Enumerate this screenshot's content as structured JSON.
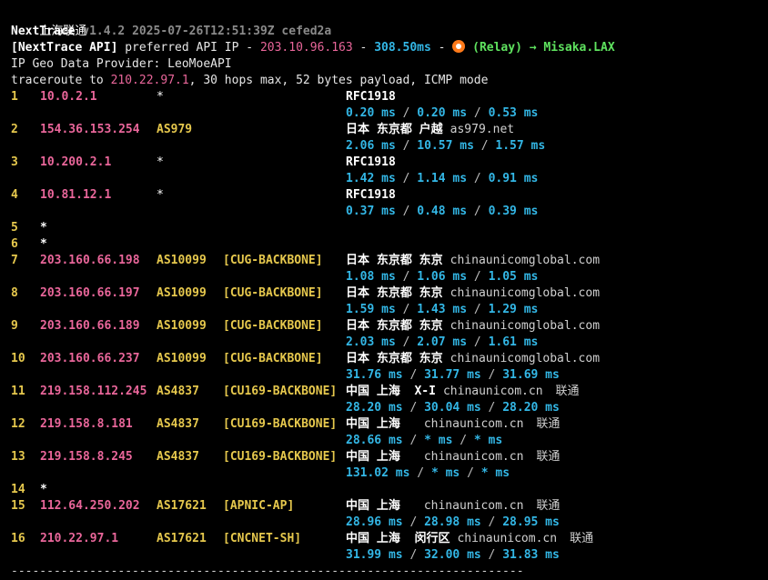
{
  "header": {
    "title": "上海联通",
    "app_name": "NextTrace",
    "version_info": "v1.4.2 2025-07-26T12:51:39Z cefed2a",
    "api_label": "[NextTrace API]",
    "api_text": "preferred API IP -",
    "api_ip": "203.10.96.163",
    "api_dash": "-",
    "api_latency": "308.50ms",
    "api_dash2": "-",
    "relay_text": "(Relay) → Misaka.LAX",
    "geo_provider": "IP Geo Data Provider: LeoMoeAPI",
    "traceroute_prefix": "traceroute to",
    "traceroute_target": "210.22.97.1",
    "traceroute_suffix": ", 30 hops max, 52 bytes payload, ICMP mode"
  },
  "hops": [
    {
      "num": "1",
      "ip": "10.0.2.1",
      "asn": "*",
      "tag": "",
      "geo": "RFC1918",
      "host": "",
      "isp": "",
      "rtt": [
        "0.20 ms",
        "0.20 ms",
        "0.53 ms"
      ]
    },
    {
      "num": "2",
      "ip": "154.36.153.254",
      "asn": "AS979",
      "tag": "",
      "geo": "日本 东京都 户越",
      "host": "as979.net",
      "isp": "",
      "rtt": [
        "2.06 ms",
        "10.57 ms",
        "1.57 ms"
      ]
    },
    {
      "num": "3",
      "ip": "10.200.2.1",
      "asn": "*",
      "tag": "",
      "geo": "RFC1918",
      "host": "",
      "isp": "",
      "rtt": [
        "1.42 ms",
        "1.14 ms",
        "0.91 ms"
      ]
    },
    {
      "num": "4",
      "ip": "10.81.12.1",
      "asn": "*",
      "tag": "",
      "geo": "RFC1918",
      "host": "",
      "isp": "",
      "rtt": [
        "0.37 ms",
        "0.48 ms",
        "0.39 ms"
      ]
    },
    {
      "num": "5",
      "star": "*"
    },
    {
      "num": "6",
      "star": "*"
    },
    {
      "num": "7",
      "ip": "203.160.66.198",
      "asn": "AS10099",
      "tag": "[CUG-BACKBONE]",
      "geo": "日本 东京都 东京",
      "host": "chinaunicomglobal.com",
      "isp": "",
      "rtt": [
        "1.08 ms",
        "1.06 ms",
        "1.05 ms"
      ]
    },
    {
      "num": "8",
      "ip": "203.160.66.197",
      "asn": "AS10099",
      "tag": "[CUG-BACKBONE]",
      "geo": "日本 东京都 东京",
      "host": "chinaunicomglobal.com",
      "isp": "",
      "rtt": [
        "1.59 ms",
        "1.43 ms",
        "1.29 ms"
      ]
    },
    {
      "num": "9",
      "ip": "203.160.66.189",
      "asn": "AS10099",
      "tag": "[CUG-BACKBONE]",
      "geo": "日本 东京都 东京",
      "host": "chinaunicomglobal.com",
      "isp": "",
      "rtt": [
        "2.03 ms",
        "2.07 ms",
        "1.61 ms"
      ]
    },
    {
      "num": "10",
      "ip": "203.160.66.237",
      "asn": "AS10099",
      "tag": "[CUG-BACKBONE]",
      "geo": "日本 东京都 东京",
      "host": "chinaunicomglobal.com",
      "isp": "",
      "rtt": [
        "31.76 ms",
        "31.77 ms",
        "31.69 ms"
      ]
    },
    {
      "num": "11",
      "ip": "219.158.112.245",
      "asn": "AS4837",
      "tag": "[CU169-BACKBONE]",
      "geo": "中国 上海  X-I",
      "host": "chinaunicom.cn",
      "isp": "联通",
      "rtt": [
        "28.20 ms",
        "30.04 ms",
        "28.20 ms"
      ]
    },
    {
      "num": "12",
      "ip": "219.158.8.181",
      "asn": "AS4837",
      "tag": "[CU169-BACKBONE]",
      "geo": "中国 上海",
      "host": "chinaunicom.cn",
      "isp": "联通",
      "rtt": [
        "28.66 ms",
        "* ms",
        "* ms"
      ]
    },
    {
      "num": "13",
      "ip": "219.158.8.245",
      "asn": "AS4837",
      "tag": "[CU169-BACKBONE]",
      "geo": "中国 上海",
      "host": "chinaunicom.cn",
      "isp": "联通",
      "rtt": [
        "131.02 ms",
        "* ms",
        "* ms"
      ]
    },
    {
      "num": "14",
      "star": "*"
    },
    {
      "num": "15",
      "ip": "112.64.250.202",
      "asn": "AS17621",
      "tag": "[APNIC-AP]",
      "geo": "中国 上海",
      "host": "chinaunicom.cn",
      "isp": "联通",
      "rtt": [
        "28.96 ms",
        "28.98 ms",
        "28.95 ms"
      ]
    },
    {
      "num": "16",
      "ip": "210.22.97.1",
      "asn": "AS17621",
      "tag": "[CNCNET-SH]",
      "geo": "中国 上海  闵行区",
      "host": "chinaunicom.cn",
      "isp": "联通",
      "rtt": [
        "31.99 ms",
        "32.00 ms",
        "31.83 ms"
      ]
    }
  ],
  "footer": {
    "divider": "------------------------------------------------------------------------"
  },
  "colors": {
    "background": "#000000",
    "ip": "#e9669a",
    "rtt": "#33b7e6",
    "asn": "#e6c84d",
    "relay": "#5fe35f"
  },
  "icons": {
    "relay": "relay-fish-icon"
  }
}
